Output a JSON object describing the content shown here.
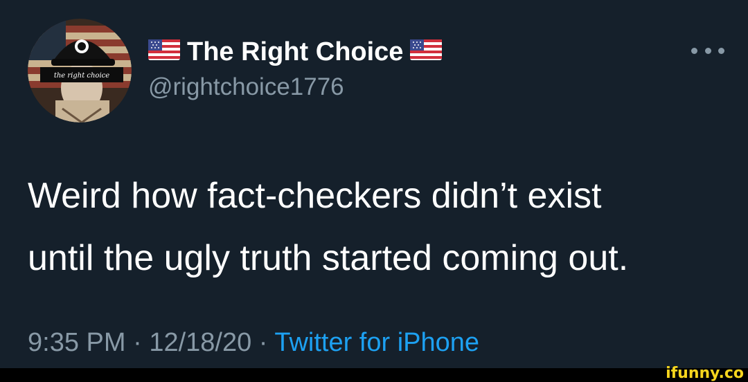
{
  "tweet": {
    "display_name": "The Right Choice",
    "name_prefix_emoji": "flag-us",
    "name_suffix_emoji": "flag-us",
    "handle": "@rightchoice1776",
    "avatar_text": "the right choice",
    "text_line1": "Weird how fact-checkers didn’t exist",
    "text_line2": "until the ugly truth started coming out.",
    "time": "9:35 PM",
    "separator": "·",
    "date": "12/18/20",
    "source": "Twitter for iPhone"
  },
  "icons": {
    "more": "more-horizontal-icon",
    "flag": "us-flag-icon"
  },
  "watermark": "ifunny.co",
  "colors": {
    "background": "#15202b",
    "primary_text": "#ffffff",
    "secondary_text": "#8899a6",
    "link": "#1da1f2",
    "watermark": "#f7d51d"
  }
}
